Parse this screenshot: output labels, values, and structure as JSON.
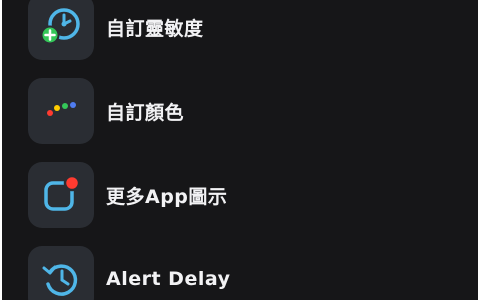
{
  "settings_list": {
    "items": [
      {
        "label": "自訂靈敏度",
        "icon": "sensitivity-gauge-add-icon"
      },
      {
        "label": "自訂顏色",
        "icon": "color-dots-icon"
      },
      {
        "label": "更多App圖示",
        "icon": "app-icon-badge-icon"
      },
      {
        "label": "Alert Delay",
        "icon": "history-clock-icon"
      }
    ]
  },
  "colors": {
    "background": "#161618",
    "tile": "#2a2d33",
    "accent_blue": "#4fb6e8",
    "accent_green": "#34c759",
    "accent_red": "#ff3b30",
    "text": "#f2f2f4"
  }
}
